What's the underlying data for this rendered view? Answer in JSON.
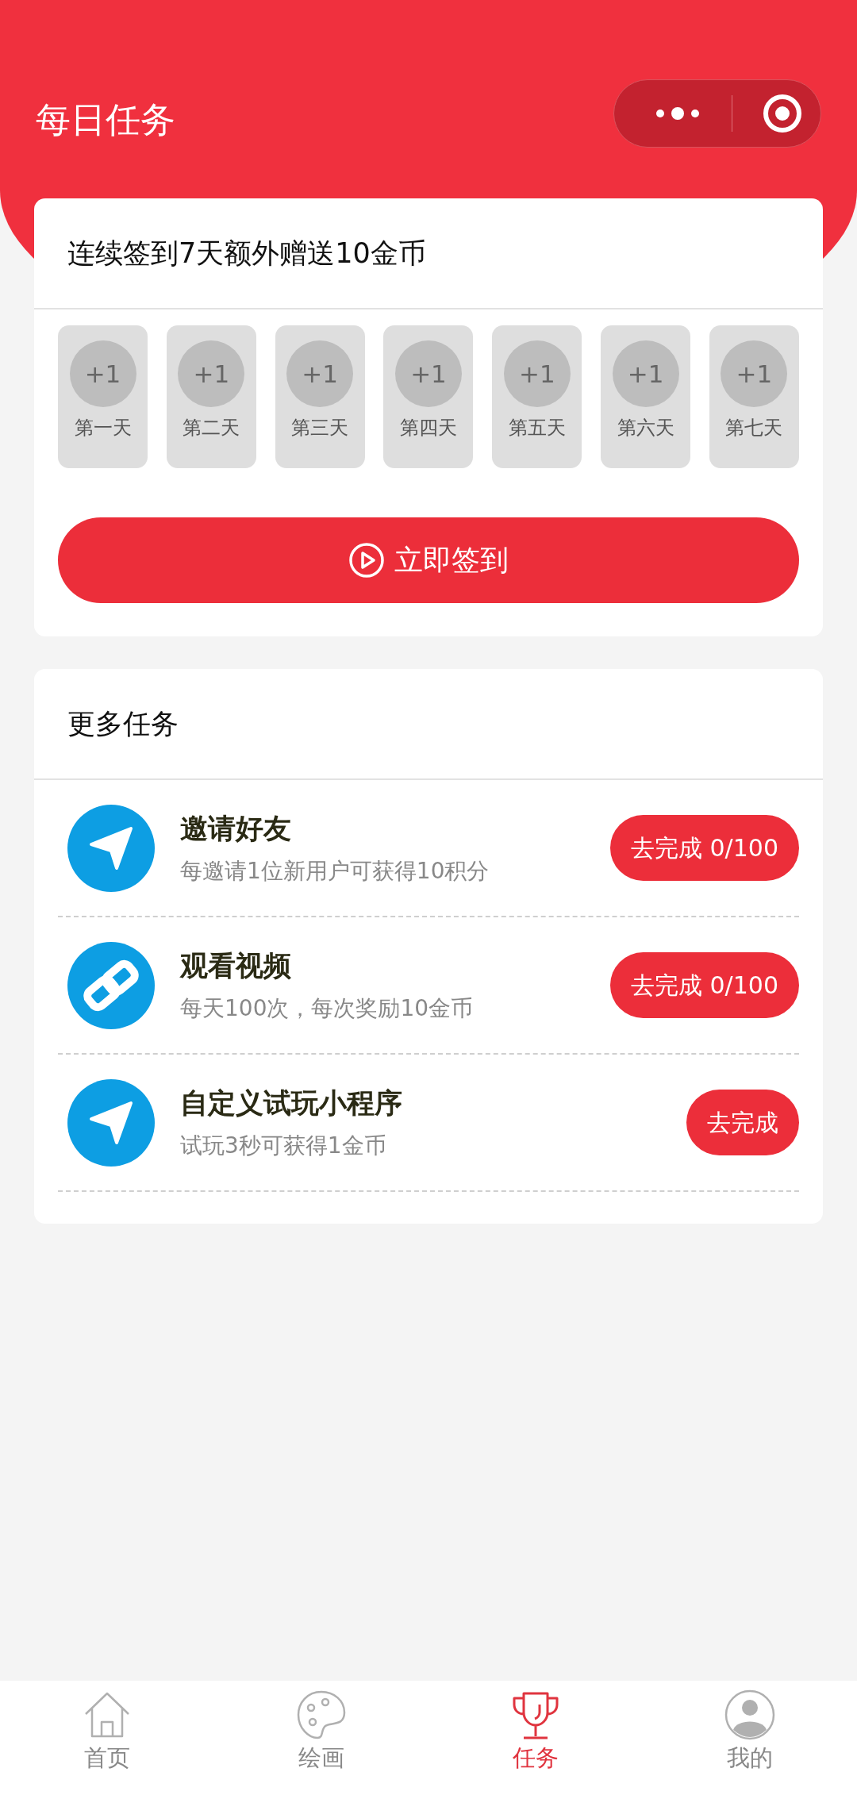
{
  "header": {
    "title": "每日任务"
  },
  "signin": {
    "title": "连续签到7天额外赠送10金币",
    "button": "立即签到",
    "days": [
      {
        "reward": "+1",
        "label": "第一天",
        "checked": false
      },
      {
        "reward": "+1",
        "label": "第二天",
        "checked": false
      },
      {
        "reward": "+1",
        "label": "第三天",
        "checked": false
      },
      {
        "reward": "+1",
        "label": "第四天",
        "checked": false
      },
      {
        "reward": "+1",
        "label": "第五天",
        "checked": false
      },
      {
        "reward": "+1",
        "label": "第六天",
        "checked": false
      },
      {
        "reward": "+1",
        "label": "第七天",
        "checked": false
      }
    ]
  },
  "more_tasks": {
    "title": "更多任务",
    "tasks": [
      {
        "kind": "send",
        "title": "邀请好友",
        "desc": "每邀请1位新用户可获得10积分",
        "button": "去完成 0/100"
      },
      {
        "kind": "link",
        "title": "观看视频",
        "desc": "每天100次，每次奖励10金币",
        "button": "去完成 0/100"
      },
      {
        "kind": "send",
        "title": "自定义试玩小程序",
        "desc": "试玩3秒可获得1金币",
        "button": "去完成"
      }
    ]
  },
  "tab_bar": [
    {
      "kind": "home",
      "label": "首页",
      "selected": false
    },
    {
      "kind": "palette",
      "label": "绘画",
      "selected": false
    },
    {
      "kind": "trophy",
      "label": "任务",
      "selected": true
    },
    {
      "kind": "user",
      "label": "我的",
      "selected": false
    }
  ]
}
